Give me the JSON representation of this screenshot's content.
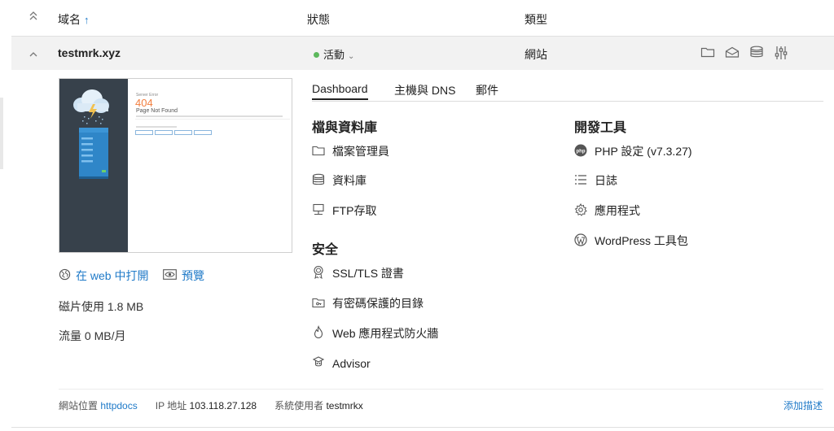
{
  "table": {
    "headers": {
      "domain": "域名",
      "status": "狀態",
      "type": "類型"
    }
  },
  "row": {
    "domain": "testmrk.xyz",
    "status": "活動",
    "status_color": "#5cb85c",
    "type": "網站",
    "icons": [
      "folder-icon",
      "mail-icon",
      "database-icon",
      "settings-sliders-icon"
    ]
  },
  "preview": {
    "label": "Server Error",
    "code": "404",
    "message": "Page Not Found"
  },
  "links": {
    "open_in_web": "在 web 中打開",
    "preview": "預覽"
  },
  "stats": {
    "disk": "磁片使用 1.8 MB",
    "traffic": "流量 0 MB/月"
  },
  "tabs": [
    "Dashboard",
    "主機與 DNS",
    "郵件"
  ],
  "sections": {
    "files_db": {
      "title": "檔與資料庫",
      "items": [
        "檔案管理員",
        "資料庫",
        "FTP存取"
      ]
    },
    "security": {
      "title": "安全",
      "items": [
        "SSL/TLS 證書",
        "有密碼保護的目錄",
        "Web 應用程式防火牆",
        "Advisor"
      ]
    },
    "dev_tools": {
      "title": "開發工具",
      "items": [
        "PHP 設定 (v7.3.27)",
        "日誌",
        "應用程式",
        "WordPress 工具包"
      ]
    }
  },
  "footer": {
    "site_location_label": "網站位置",
    "site_location_value": "httpdocs",
    "ip_label": "IP 地址",
    "ip_value": "103.118.27.128",
    "sysuser_label": "系統使用者",
    "sysuser_value": "testmrkx",
    "add_description": "添加描述"
  },
  "colors": {
    "accent": "#1f7ac8",
    "error_orange": "#f27e3f"
  }
}
